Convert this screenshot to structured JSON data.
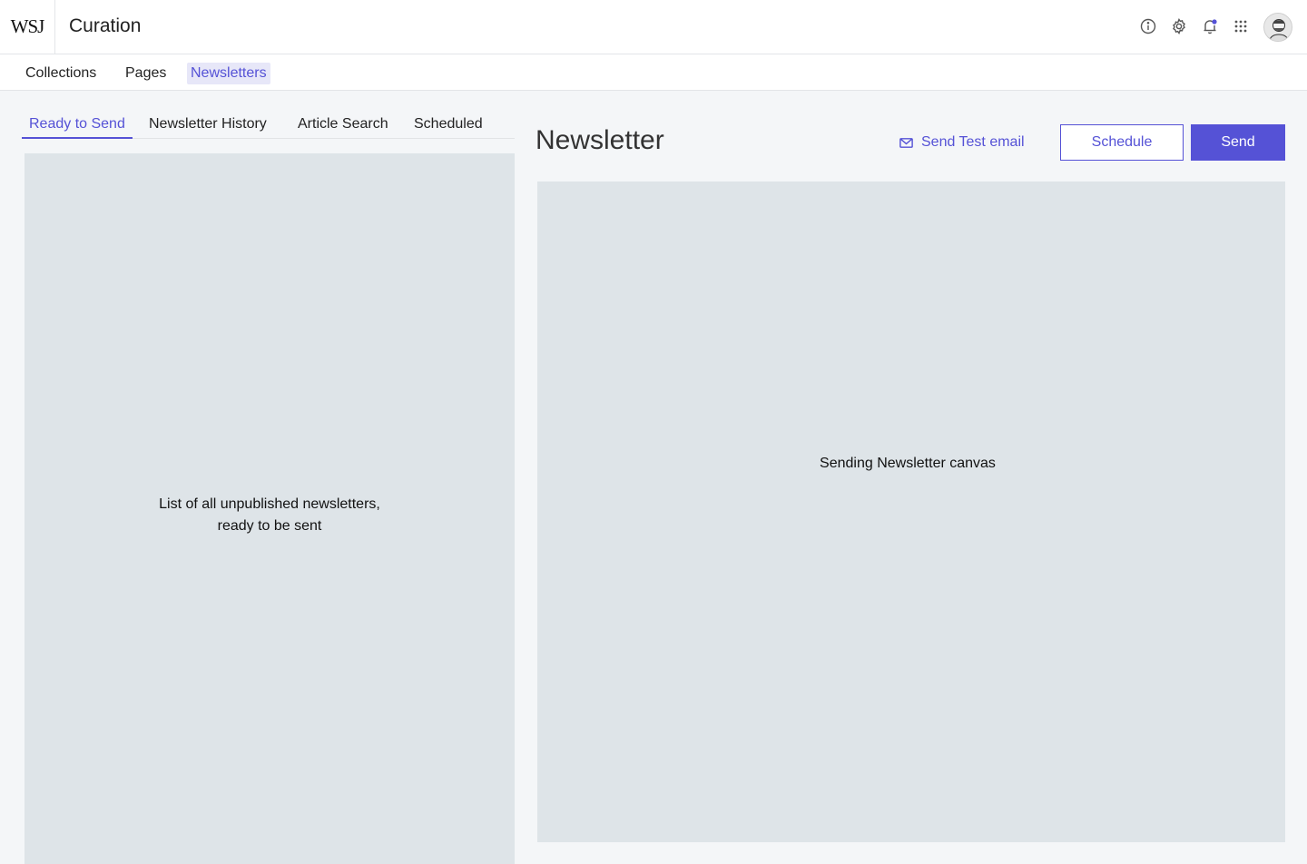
{
  "header": {
    "logo_text": "WSJ",
    "app_title": "Curation",
    "icons": [
      "info-icon",
      "gear-icon",
      "bell-icon",
      "apps-grid-icon"
    ],
    "notification_dot_color": "#5552d6"
  },
  "main_nav": {
    "items": [
      {
        "label": "Collections"
      },
      {
        "label": "Pages"
      },
      {
        "label": "Newsletters"
      }
    ],
    "active": "Newsletters"
  },
  "left": {
    "tabs": [
      {
        "label": "Ready to Send"
      },
      {
        "label": "Newsletter History"
      },
      {
        "label": "Article Search"
      },
      {
        "label": "Scheduled"
      }
    ],
    "active_tab": "Ready to Send",
    "placeholder_line1": "List of all unpublished newsletters,",
    "placeholder_line2": "ready to be sent"
  },
  "right": {
    "title": "Newsletter",
    "test_email_label": "Send Test email",
    "schedule_label": "Schedule",
    "send_label": "Send",
    "canvas_placeholder": "Sending Newsletter canvas"
  },
  "colors": {
    "accent": "#5552d6",
    "panel_bg": "#dee4e8",
    "page_bg": "#f4f6f8"
  }
}
